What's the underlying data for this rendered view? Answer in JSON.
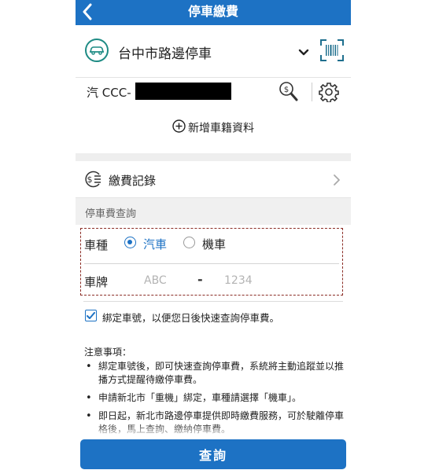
{
  "header": {
    "title": "停車繳費",
    "back_icon": "chevron-left-icon"
  },
  "area": {
    "name": "台中市路邊停車",
    "icon": "car-icon",
    "dropdown_icon": "chevron-down-icon",
    "scan_icon": "barcode-scan-icon"
  },
  "vehicle": {
    "plate_display": "汽 CCC-",
    "search_icon": "coin-search-icon",
    "settings_icon": "gear-icon"
  },
  "add_vehicle": {
    "label": "新增車籍資料",
    "icon": "plus-circle-icon"
  },
  "records": {
    "label": "繳費記錄",
    "icon": "payment-list-icon",
    "chevron_icon": "chevron-right-icon"
  },
  "query": {
    "section_title": "停車費查詢",
    "type_label": "車種",
    "type_options": [
      "汽車",
      "機車"
    ],
    "type_selected": "汽車",
    "plate_label": "車牌",
    "plate_prefix_placeholder": "ABC",
    "plate_separator": "-",
    "plate_suffix_placeholder": "1234"
  },
  "bind": {
    "label": "綁定車號，以便您日後快速查詢停車費。",
    "checked": true
  },
  "notes": {
    "title": "注意事項：",
    "items": [
      "綁定車號後，即可快速查詢停車費，系統將主動追蹤並以推播方式提醒待繳停車費。",
      "申請新北市「重機」綁定，車種請選擇「機車」。",
      "即日起，新北市路邊停車提供即時繳費服務，可於駛離停車格後，馬上查詢、繳納停車費。"
    ]
  },
  "submit": {
    "label": "查詢"
  },
  "colors": {
    "primary": "#1d72c4",
    "accent_teal": "#1e8b84",
    "highlight_border": "#8b2c25"
  }
}
